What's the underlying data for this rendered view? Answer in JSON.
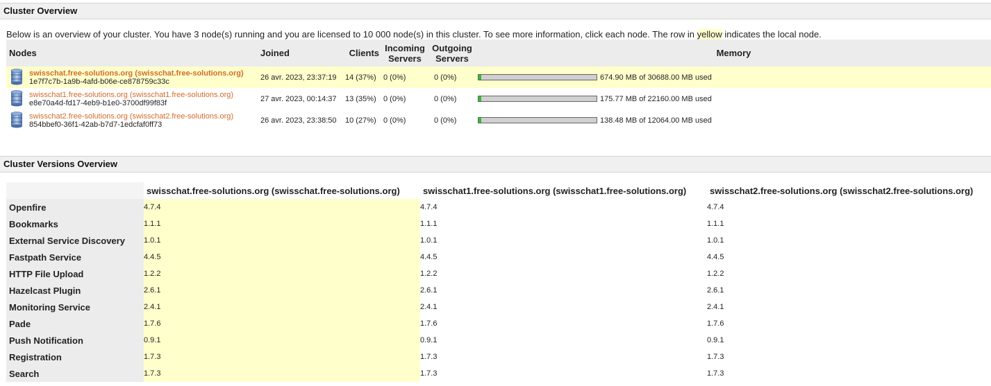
{
  "cluster_overview": {
    "title": "Cluster Overview",
    "intro_pre": "Below is an overview of your cluster. You have 3 node(s) running and you are licensed to 10 000 node(s) in this cluster. To see more information, click each node. The row in ",
    "intro_highlight": "yellow",
    "intro_post": " indicates the local node.",
    "columns": {
      "nodes": "Nodes",
      "joined": "Joined",
      "clients": "Clients",
      "incoming_1": "Incoming",
      "incoming_2": "Servers",
      "outgoing_1": "Outgoing",
      "outgoing_2": "Servers",
      "memory": "Memory"
    },
    "nodes": [
      {
        "host": "swisschat.free-solutions.org (swisschat.free-solutions.org)",
        "id": "1e7f7c7b-1a9b-4afd-b06e-ce878759c33c",
        "joined": "26 avr. 2023, 23:37:19",
        "clients": "14 (37%)",
        "incoming": "0 (0%)",
        "outgoing": "0 (0%)",
        "memory_used_fraction": 0.022,
        "memory_text": "674.90 MB of 30688.00 MB used",
        "local": true
      },
      {
        "host": "swisschat1.free-solutions.org (swisschat1.free-solutions.org)",
        "id": "e8e70a4d-fd17-4eb9-b1e0-3700df99f83f",
        "joined": "27 avr. 2023, 00:14:37",
        "clients": "13 (35%)",
        "incoming": "0 (0%)",
        "outgoing": "0 (0%)",
        "memory_used_fraction": 0.008,
        "memory_text": "175.77 MB of 22160.00 MB used",
        "local": false
      },
      {
        "host": "swisschat2.free-solutions.org (swisschat2.free-solutions.org)",
        "id": "854bbef0-36f1-42ab-b7d7-1edcfaf0ff73",
        "joined": "26 avr. 2023, 23:38:50",
        "clients": "10 (27%)",
        "incoming": "0 (0%)",
        "outgoing": "0 (0%)",
        "memory_used_fraction": 0.011,
        "memory_text": "138.48 MB of 12064.00 MB used",
        "local": false
      }
    ],
    "colors": {
      "local_highlight": "#ffffcc",
      "host_link": "#d46b2a",
      "memory_fill": "#33bb33"
    }
  },
  "versions_overview": {
    "title": "Cluster Versions Overview",
    "columns": [
      "swisschat.free-solutions.org (swisschat.free-solutions.org)",
      "swisschat1.free-solutions.org (swisschat1.free-solutions.org)",
      "swisschat2.free-solutions.org (swisschat2.free-solutions.org)"
    ],
    "rows": [
      {
        "name": "Openfire",
        "values": [
          "4.7.4",
          "4.7.4",
          "4.7.4"
        ]
      },
      {
        "name": "Bookmarks",
        "values": [
          "1.1.1",
          "1.1.1",
          "1.1.1"
        ]
      },
      {
        "name": "External Service Discovery",
        "values": [
          "1.0.1",
          "1.0.1",
          "1.0.1"
        ]
      },
      {
        "name": "Fastpath Service",
        "values": [
          "4.4.5",
          "4.4.5",
          "4.4.5"
        ]
      },
      {
        "name": "HTTP File Upload",
        "values": [
          "1.2.2",
          "1.2.2",
          "1.2.2"
        ]
      },
      {
        "name": "Hazelcast Plugin",
        "values": [
          "2.6.1",
          "2.6.1",
          "2.6.1"
        ]
      },
      {
        "name": "Monitoring Service",
        "values": [
          "2.4.1",
          "2.4.1",
          "2.4.1"
        ]
      },
      {
        "name": "Pade",
        "values": [
          "1.7.6",
          "1.7.6",
          "1.7.6"
        ]
      },
      {
        "name": "Push Notification",
        "values": [
          "0.9.1",
          "0.9.1",
          "0.9.1"
        ]
      },
      {
        "name": "Registration",
        "values": [
          "1.7.3",
          "1.7.3",
          "1.7.3"
        ]
      },
      {
        "name": "Search",
        "values": [
          "1.7.3",
          "1.7.3",
          "1.7.3"
        ]
      }
    ]
  }
}
